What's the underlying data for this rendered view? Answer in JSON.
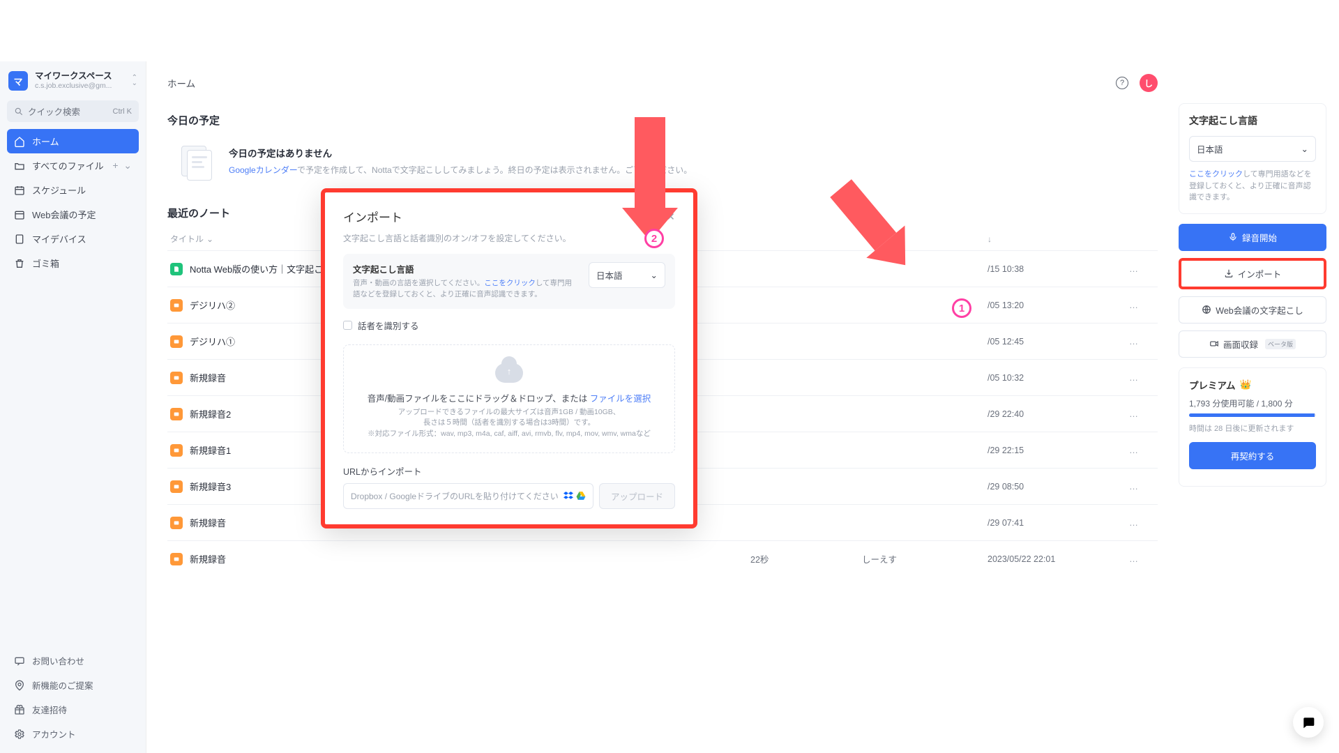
{
  "workspace": {
    "avatar_text": "マ",
    "name": "マイワークスペース",
    "email": "c.s.job.exclusive@gm...",
    "caret_up": "⌃",
    "caret_down": "⌄"
  },
  "search": {
    "label": "クイック検索",
    "shortcut": "Ctrl  K"
  },
  "nav": {
    "home": "ホーム",
    "all_files": "すべてのファイル",
    "schedule": "スケジュール",
    "meetings": "Web会議の予定",
    "devices": "マイデバイス",
    "trash": "ゴミ箱"
  },
  "footer_nav": {
    "contact": "お問い合わせ",
    "features": "新機能のご提案",
    "invite": "友達招待",
    "account": "アカウント"
  },
  "header": {
    "title": "ホーム",
    "help": "?",
    "user_initial": "し"
  },
  "schedule": {
    "heading": "今日の予定",
    "empty_title": "今日の予定はありません",
    "empty_body_prefix": "",
    "empty_link": "Googleカレンダー",
    "empty_body_suffix": "で予定を作成して、Nottaで文字起こししてみましょう。終日の予定は表示されません。ご了承ください。"
  },
  "notes": {
    "heading": "最近のノート",
    "columns": {
      "title": "タイトル",
      "sort": "⌄",
      "date_sort": "↓"
    },
    "rows": [
      {
        "icon": "green",
        "title": "Notta Web版の使い方｜文字起こし方法お",
        "dur": "",
        "creator": "",
        "date": "/15 10:38"
      },
      {
        "icon": "orange",
        "title": "デジリハ②",
        "dur": "",
        "creator": "",
        "date": "/05 13:20"
      },
      {
        "icon": "orange",
        "title": "デジリハ①",
        "dur": "",
        "creator": "",
        "date": "/05 12:45"
      },
      {
        "icon": "orange",
        "title": "新規録音",
        "dur": "",
        "creator": "",
        "date": "/05 10:32"
      },
      {
        "icon": "orange",
        "title": "新規録音2",
        "dur": "",
        "creator": "",
        "date": "/29 22:40"
      },
      {
        "icon": "orange",
        "title": "新規録音1",
        "dur": "",
        "creator": "",
        "date": "/29 22:15"
      },
      {
        "icon": "orange",
        "title": "新規録音3",
        "dur": "",
        "creator": "",
        "date": "/29 08:50"
      },
      {
        "icon": "orange",
        "title": "新規録音",
        "dur": "",
        "creator": "",
        "date": "/29 07:41"
      },
      {
        "icon": "orange",
        "title": "新規録音",
        "dur": "22秒",
        "creator": "しーえす",
        "date": "2023/05/22 22:01"
      }
    ],
    "more": "…"
  },
  "right": {
    "lang_heading": "文字起こし言語",
    "lang_value": "日本語",
    "lang_hint_link": "ここをクリック",
    "lang_hint_text": "して専門用語などを登録しておくと、より正確に音声認識できます。",
    "btn_record": "録音開始",
    "btn_import": "インポート",
    "btn_meeting": "Web会議の文字起こし",
    "btn_screen": "画面収録",
    "beta": "ベータ版",
    "premium": "プレミアム",
    "usage": "1,793 分使用可能 / 1,800 分",
    "renew": "時間は 28 日後に更新されます",
    "btn_renew": "再契約する"
  },
  "modal": {
    "title": "インポート",
    "subtitle": "文字起こし言語と話者識別のオン/オフを設定してください。",
    "lang_label": "文字起こし言語",
    "lang_desc_prefix": "音声・動画の言語を選択してください。",
    "lang_desc_link": "ここをクリック",
    "lang_desc_suffix": "して専門用語などを登録しておくと、より正確に音声認識できます。",
    "lang_value": "日本語",
    "speaker_label": "話者を識別する",
    "dz_main_prefix": "音声/動画ファイルをここにドラッグ＆ドロップ、または",
    "dz_main_link": "ファイルを選択",
    "dz_sub1": "アップロードできるファイルの最大サイズは音声1GB / 動画10GB、",
    "dz_sub2": "長さは５時間（話者を識別する場合は3時間）です。",
    "dz_sub3": "※対応ファイル形式：wav, mp3, m4a, caf, aiff, avi, rmvb, flv, mp4, mov, wmv, wmaなど",
    "url_label": "URLからインポート",
    "url_placeholder": "Dropbox / GoogleドライブのURLを貼り付けてください",
    "upload": "アップロード"
  },
  "annotations": {
    "num1": "1",
    "num2": "2"
  }
}
